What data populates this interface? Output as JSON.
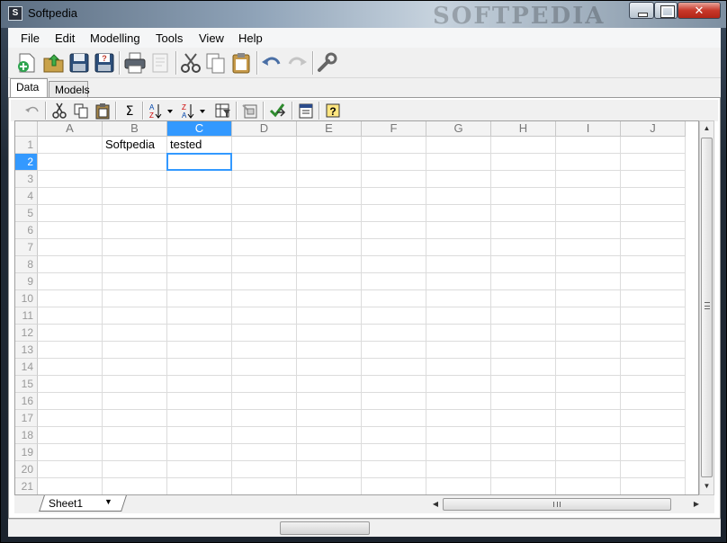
{
  "window": {
    "title": "Softpedia",
    "watermark": "SOFTPEDIA",
    "close_glyph": "✕"
  },
  "menu": {
    "items": [
      "File",
      "Edit",
      "Modelling",
      "Tools",
      "View",
      "Help"
    ]
  },
  "main_toolbar": {
    "icons": [
      "new-icon",
      "open-icon",
      "save-icon",
      "save-as-icon",
      "print-icon",
      "print-preview-icon",
      "cut-icon",
      "copy-icon",
      "paste-icon",
      "undo-icon",
      "redo-icon",
      "settings-wrench-icon"
    ]
  },
  "tabs": [
    {
      "label": "Data",
      "active": true
    },
    {
      "label": "Models",
      "active": false
    }
  ],
  "grid_toolbar": {
    "icons": [
      "undo-icon",
      "cut-icon",
      "copy-icon",
      "paste-icon",
      "sum-icon",
      "sort-ascending-icon",
      "sort-descending-icon",
      "filter-icon",
      "import-icon",
      "check-icon",
      "clipboard-icon",
      "help-icon"
    ]
  },
  "sheet": {
    "columns": [
      "A",
      "B",
      "C",
      "D",
      "E",
      "F",
      "G",
      "H",
      "I",
      "J"
    ],
    "rows": [
      "1",
      "2",
      "3",
      "4",
      "5",
      "6",
      "7",
      "8",
      "9",
      "10",
      "11",
      "12",
      "13",
      "14",
      "15",
      "16",
      "17",
      "18",
      "19",
      "20",
      "21"
    ],
    "selected_column": "C",
    "selected_row": "2",
    "cells": [
      {
        "ref": "B1",
        "row": 1,
        "col": 2,
        "value": "Softpedia"
      },
      {
        "ref": "C1",
        "row": 1,
        "col": 3,
        "value": "tested"
      }
    ],
    "active_cell": "C2",
    "sheet_tabs": [
      {
        "label": "Sheet1"
      }
    ]
  },
  "colors": {
    "selection": "#3399ff",
    "header_bg": "#f3f3f3",
    "grid_line": "#dcdcdc"
  }
}
